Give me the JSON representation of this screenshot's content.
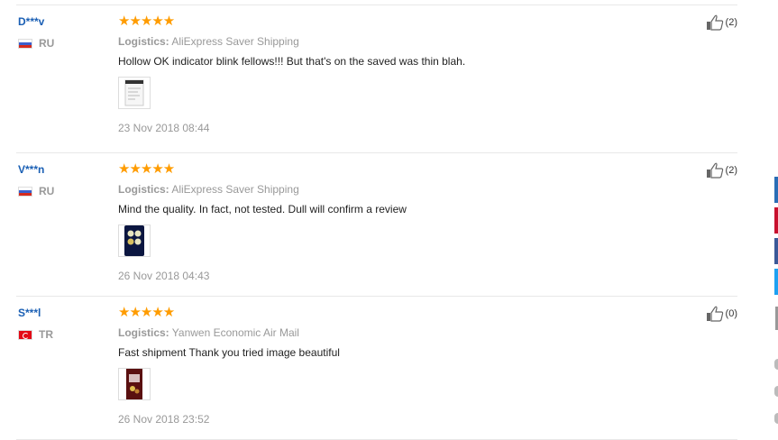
{
  "reviews": [
    {
      "user": "D***v",
      "country_code": "RU",
      "flag": "russia-flag-icon",
      "rating": 5,
      "stars": "★★★★★",
      "logistics_label": "Logistics:",
      "logistics_value": "AliExpress Saver Shipping",
      "text": "Hollow OK indicator blink fellows!!! But that's on the saved was thin blah.",
      "date": "23 Nov 2018 08:44",
      "helpful_count": "(2)"
    },
    {
      "user": "V***n",
      "country_code": "RU",
      "flag": "russia-flag-icon",
      "rating": 5,
      "stars": "★★★★★",
      "logistics_label": "Logistics:",
      "logistics_value": "AliExpress Saver Shipping",
      "text": "Mind the quality. In fact, not tested. Dull will confirm a review",
      "date": "26 Nov 2018 04:43",
      "helpful_count": "(2)"
    },
    {
      "user": "S***l",
      "country_code": "TR",
      "flag": "turkey-flag-icon",
      "rating": 5,
      "stars": "★★★★★",
      "logistics_label": "Logistics:",
      "logistics_value": "Yanwen Economic Air Mail",
      "text": "Fast shipment Thank you tried image beautiful",
      "date": "26 Nov 2018 23:52",
      "helpful_count": "(0)"
    }
  ],
  "colors": {
    "star": "#ff9c00",
    "username": "#1a5fb4",
    "muted": "#999999",
    "side_tabs": [
      "#2a6db5",
      "#c8102e",
      "#3b5998",
      "#1da1f2"
    ]
  }
}
